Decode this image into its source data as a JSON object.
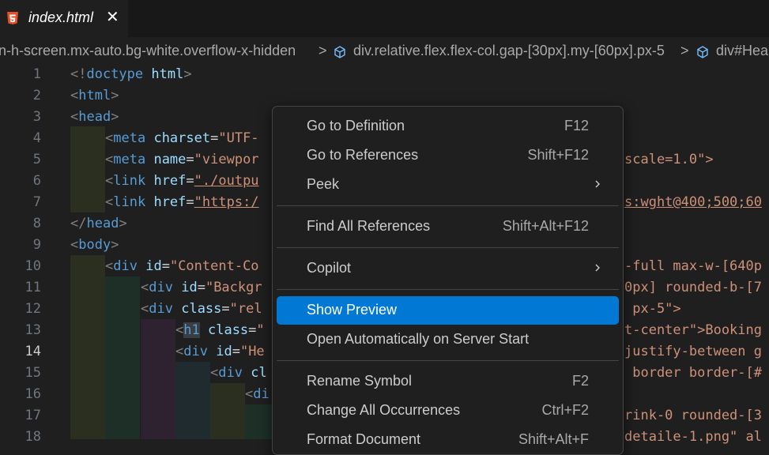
{
  "tab": {
    "title": "index.html",
    "close": "✕"
  },
  "breadcrumb": {
    "seg1": "n-h-screen.mx-auto.bg-white.overflow-x-hidden",
    "seg2": "div.relative.flex.flex-col.gap-[30px].my-[60px].px-5",
    "seg3": "div#Hea",
    "sep": ">"
  },
  "editor": {
    "line_numbers": [
      "1",
      "2",
      "3",
      "4",
      "5",
      "6",
      "7",
      "8",
      "9",
      "10",
      "11",
      "12",
      "13",
      "14",
      "15",
      "16",
      "17",
      "18"
    ],
    "active_line": "14",
    "right_fragments": {
      "l5": "scale=1.0\">",
      "l7": "s:wght@400;500;60",
      "l10": "-full max-w-[640p",
      "l11": "0px] rounded-b-[7",
      "l12": " px-5\">",
      "l13": "t-center\">Booking",
      "l14": "justify-between g",
      "l15": " border border-[#",
      "l17": "rink-0 rounded-[3",
      "l18": "detaile-1.png\" al"
    }
  },
  "menu": {
    "items": [
      {
        "label": "Go to Definition",
        "key": "F12"
      },
      {
        "label": "Go to References",
        "key": "Shift+F12"
      },
      {
        "label": "Peek",
        "key": ""
      },
      {
        "label": "Find All References",
        "key": "Shift+Alt+F12"
      },
      {
        "label": "Copilot",
        "key": ""
      },
      {
        "label": "Show Preview",
        "key": ""
      },
      {
        "label": "Open Automatically on Server Start",
        "key": ""
      },
      {
        "label": "Rename Symbol",
        "key": "F2"
      },
      {
        "label": "Change All Occurrences",
        "key": "Ctrl+F2"
      },
      {
        "label": "Format Document",
        "key": "Shift+Alt+F"
      }
    ],
    "selected": "Show Preview"
  },
  "colors": {
    "accent": "#0078d4",
    "html_icon": "#e44d26",
    "editor_bg": "#1f1f1f"
  }
}
